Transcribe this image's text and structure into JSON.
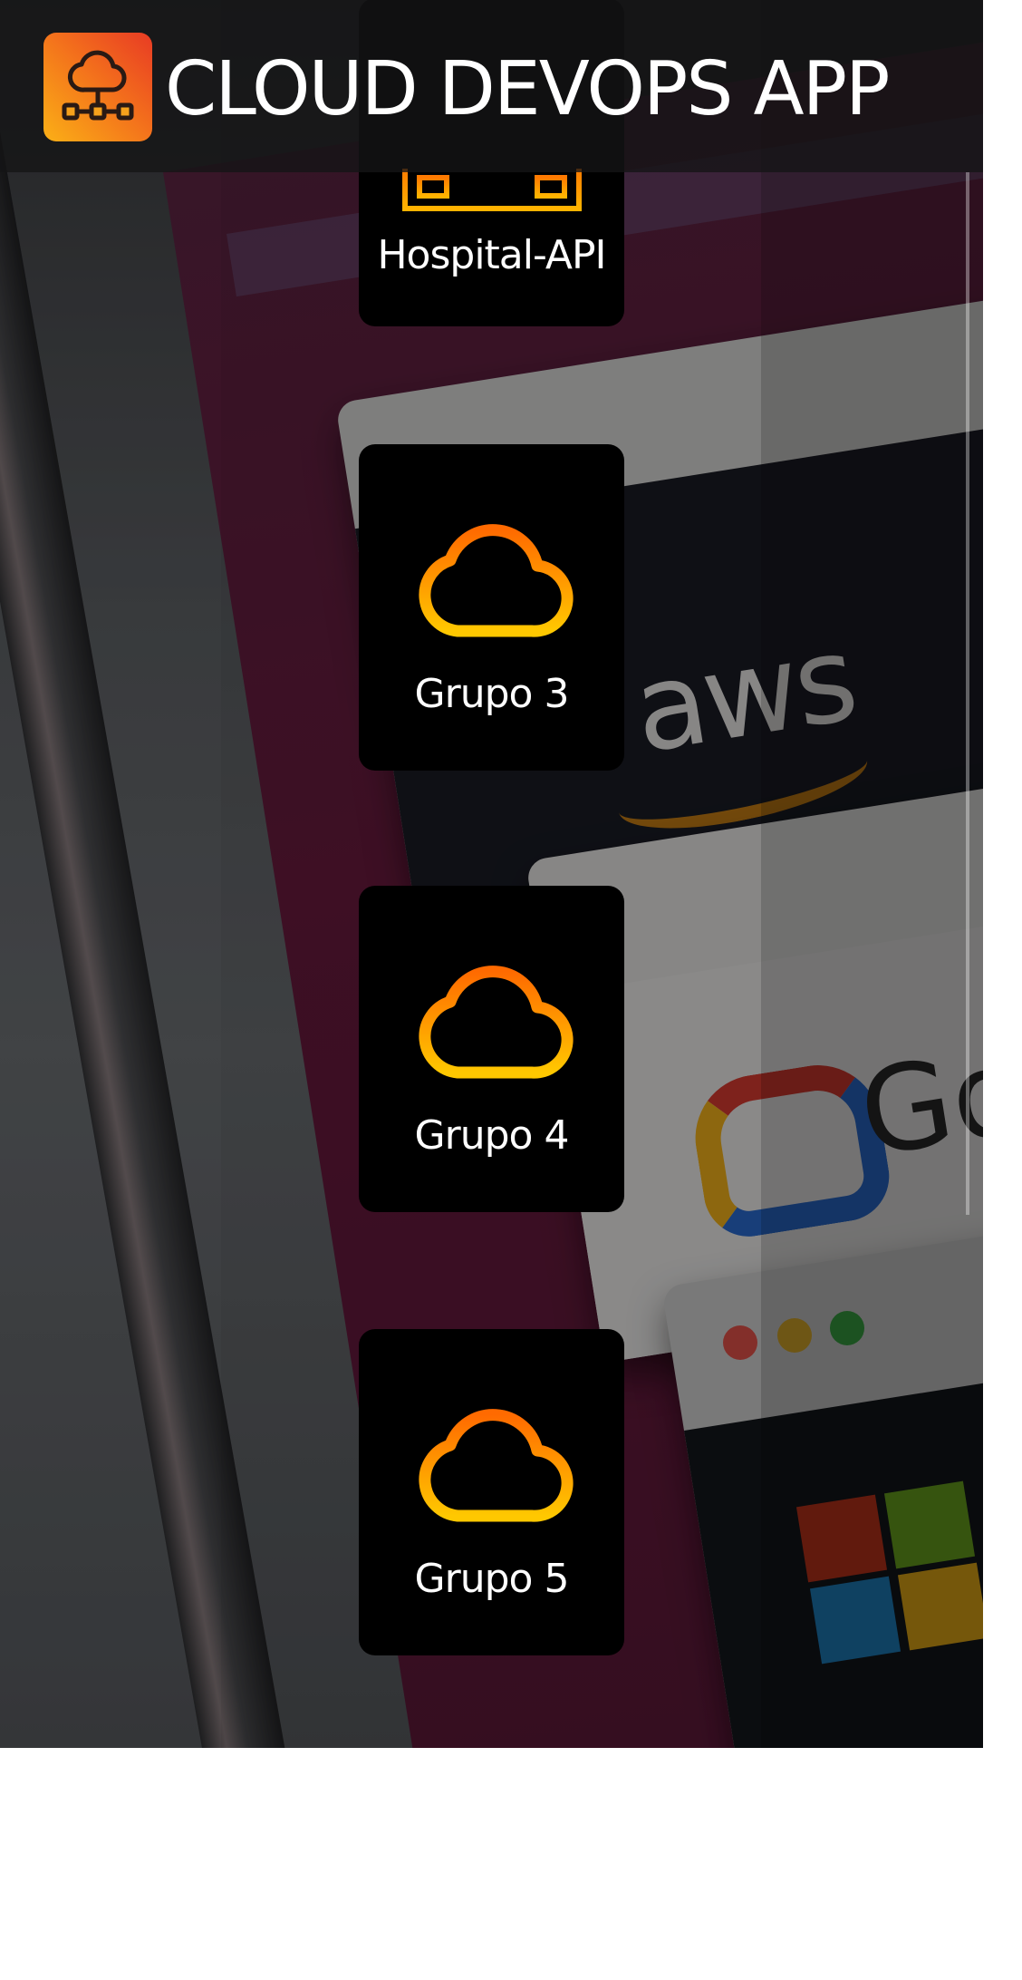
{
  "header": {
    "title": "CLOUD DEVOPS APP",
    "logo_icon": "cloud-network-icon"
  },
  "groups": [
    {
      "label": "Hospital-API",
      "icon": "server-rack-icon"
    },
    {
      "label": "Grupo 3",
      "icon": "cloud-icon"
    },
    {
      "label": "Grupo 4",
      "icon": "cloud-icon"
    },
    {
      "label": "Grupo 5",
      "icon": "cloud-icon"
    }
  ],
  "colors": {
    "accent_orange": "#ff7a00",
    "accent_yellow": "#ffc300",
    "card_bg": "#000000",
    "header_bg": "#141416"
  }
}
